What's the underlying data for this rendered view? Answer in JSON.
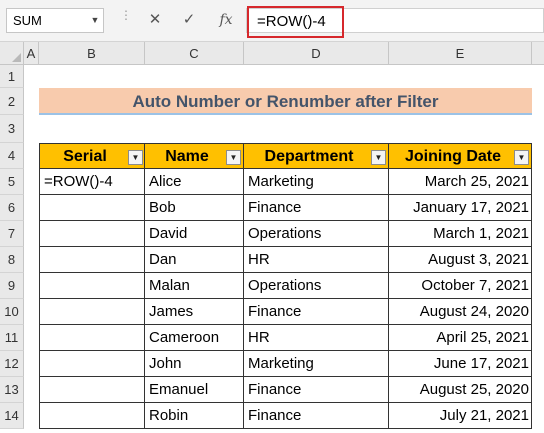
{
  "name_box": {
    "value": "SUM"
  },
  "formula_bar": {
    "cancel_symbol": "✕",
    "enter_symbol": "✓",
    "fx_label": "fx",
    "formula": "=ROW()-4"
  },
  "columns": [
    "A",
    "B",
    "C",
    "D",
    "E"
  ],
  "rows": [
    "1",
    "2",
    "3",
    "4",
    "5",
    "6",
    "7",
    "8",
    "9",
    "10",
    "11",
    "12",
    "13",
    "14"
  ],
  "title": "Auto Number or Renumber after Filter",
  "table": {
    "headers": [
      "Serial",
      "Name",
      "Department",
      "Joining Date"
    ],
    "rows": [
      {
        "serial": "=ROW()-4",
        "name": "Alice",
        "department": "Marketing",
        "date": "March 25, 2021"
      },
      {
        "serial": "",
        "name": "Bob",
        "department": "Finance",
        "date": "January 17, 2021"
      },
      {
        "serial": "",
        "name": "David",
        "department": "Operations",
        "date": "March 1, 2021"
      },
      {
        "serial": "",
        "name": "Dan",
        "department": "HR",
        "date": "August 3, 2021"
      },
      {
        "serial": "",
        "name": "Malan",
        "department": "Operations",
        "date": "October 7, 2021"
      },
      {
        "serial": "",
        "name": "James",
        "department": "Finance",
        "date": "August 24, 2020"
      },
      {
        "serial": "",
        "name": "Cameroon",
        "department": "HR",
        "date": "April 25, 2021"
      },
      {
        "serial": "",
        "name": "John",
        "department": "Marketing",
        "date": "June 17, 2021"
      },
      {
        "serial": "",
        "name": "Emanuel",
        "department": "Finance",
        "date": "August 25, 2020"
      },
      {
        "serial": "",
        "name": "Robin",
        "department": "Finance",
        "date": "July 21, 2021"
      }
    ]
  },
  "colors": {
    "title_fill": "#f8cbad",
    "title_text": "#44546a",
    "header_fill": "#ffc000",
    "highlight_border": "#d6282c"
  }
}
